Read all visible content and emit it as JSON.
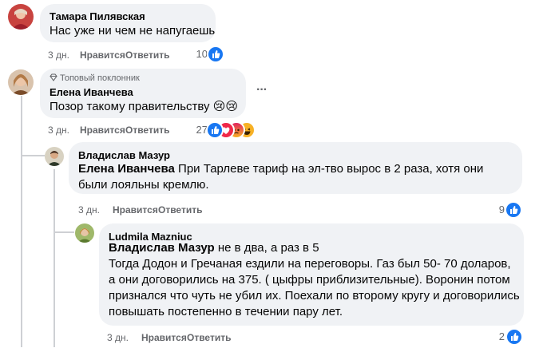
{
  "comments": [
    {
      "author": "Тамара Пилявская",
      "text": "Нас уже ни чем не напугаешь",
      "time": "3 дн.",
      "like_label": "Нравится",
      "reply_label": "Ответить",
      "reaction_count": "10"
    },
    {
      "badge": "Топовый поклонник",
      "author": "Елена Иванчева",
      "text": "Позор такому правительству 😢😢",
      "time": "3 дн.",
      "like_label": "Нравится",
      "reply_label": "Ответить",
      "reaction_count": "27",
      "more_label": "···"
    },
    {
      "author": "Владислав Мазур",
      "mention": "Елена Иванчева",
      "text": "При Тарлеве тариф на эл-тво вырос в 2 раза, хотя они были лояльны кремлю.",
      "time": "3 дн.",
      "like_label": "Нравится",
      "reply_label": "Ответить",
      "reaction_count": "9"
    },
    {
      "author": "Ludmila Mazniuc",
      "mention": "Владислав Мазур",
      "text_first": "не в два, а раз в 5",
      "text_rest": "Тогда Додон и Гречаная ездили на переговоры. Газ был 50- 70 доларов, а они договорились на 375. ( цыфры приблизительные). Воронин потом признался что чуть не убил их. Поехали по второму кругу и договорились повышать постепенно в течении пару лет.",
      "time": "3 дн.",
      "like_label": "Нравится",
      "reply_label": "Ответить",
      "reaction_count": "2"
    }
  ],
  "colors": {
    "like": "#1877f2",
    "bubble": "#f0f2f5",
    "meta": "#65676b"
  },
  "icons": [
    "like-icon",
    "love-icon",
    "angry-icon",
    "haha-icon",
    "diamond-badge-icon",
    "more-icon"
  ]
}
